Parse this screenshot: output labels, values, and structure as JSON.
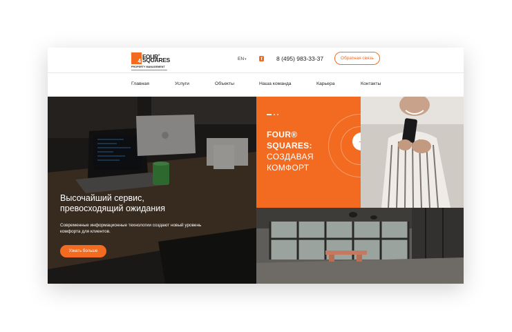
{
  "header": {
    "logo": {
      "word1": "FOUR",
      "reg": "®",
      "word2": "SQUARES",
      "number": "4",
      "sub": "PROPERTY MANAGEMENT"
    },
    "lang": "EN",
    "facebook_glyph": "f",
    "phone": "8 (495) 983-33-37",
    "callback_label": "Обратная связь"
  },
  "nav": {
    "items": [
      "Главная",
      "Услуги",
      "Объекты",
      "Наша команда",
      "Карьера",
      "Контакты"
    ]
  },
  "hero": {
    "title": "Высочайший сервис, превосходящий ожидания",
    "description": "Современные информационные технологии создают новый уровень комфорта для клиентов.",
    "button_label": "Узнать больше"
  },
  "slide": {
    "title_line1": "FOUR®",
    "title_line2": "SQUARES:",
    "title_line3": "СОЗДАВАЯ",
    "title_line4": "КОМФОРТ",
    "arrow_glyph": "→"
  },
  "colors": {
    "accent": "#f26b21",
    "text": "#222222",
    "white": "#ffffff"
  },
  "icons": [
    "facebook-icon",
    "chevron-down-icon",
    "arrow-right-icon"
  ]
}
